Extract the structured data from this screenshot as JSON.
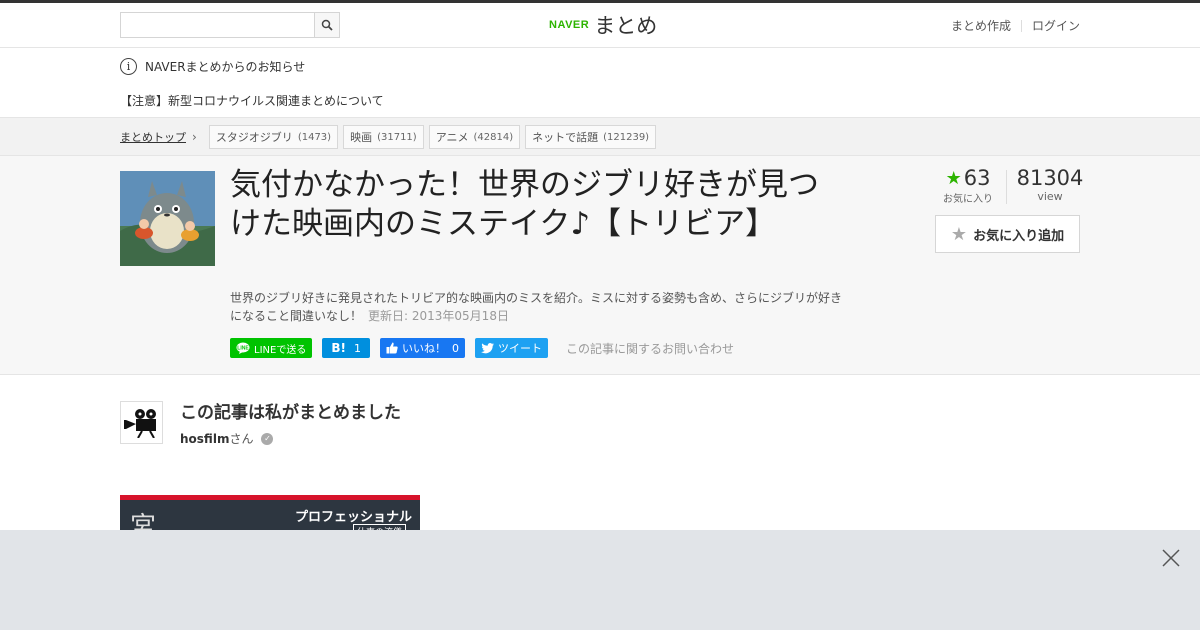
{
  "header": {
    "search_placeholder": "",
    "logo_brand": "NAVER",
    "logo_name": "まとめ",
    "nav": [
      "まとめ作成",
      "ログイン"
    ]
  },
  "notice": {
    "title": "NAVERまとめからのお知らせ",
    "item": "【注意】新型コロナウイルス関連まとめについて"
  },
  "breadcrumb": {
    "home": "まとめトップ",
    "tags": [
      {
        "label": "スタジオジブリ",
        "count": "(1473)"
      },
      {
        "label": "映画",
        "count": "(31711)"
      },
      {
        "label": "アニメ",
        "count": "(42814)"
      },
      {
        "label": "ネットで話題",
        "count": "(121239)"
      }
    ]
  },
  "article": {
    "title": "気付かなかった！世界のジブリ好きが見つけた映画内のミステイク♪【トリビア】",
    "description": "世界のジブリ好きに発見されたトリビア的な映画内のミスを紹介。ミスに対する姿勢も含め、さらにジブリが好きになること間違いなし！",
    "updated": "更新日: 2013年05月18日",
    "thumbnail_icon": "totoro-thumbnail"
  },
  "stats": {
    "favorites": "63",
    "favorites_label": "お気に入り",
    "views": "81304",
    "views_label": "view",
    "add_fav_label": "お気に入り追加"
  },
  "social": {
    "line": "LINEで送る",
    "hatena_mark": "B!",
    "hatena_count": "1",
    "fb_label": "いいね！",
    "fb_count": "0",
    "tweet": "ツイート",
    "contact": "この記事に関するお問い合わせ"
  },
  "author": {
    "heading": "この記事は私がまとめました",
    "name": "hosfilm",
    "suffix": "さん"
  },
  "article_image": {
    "left_char": "宮",
    "title": "プロフェッショナル",
    "subtitle": "仕事の流儀"
  },
  "colors": {
    "brand": "#2db400",
    "line": "#00c300",
    "hatena": "#008fde",
    "facebook": "#1877f2",
    "twitter": "#1da1f2",
    "ad_bg": "#e1e4e8"
  }
}
